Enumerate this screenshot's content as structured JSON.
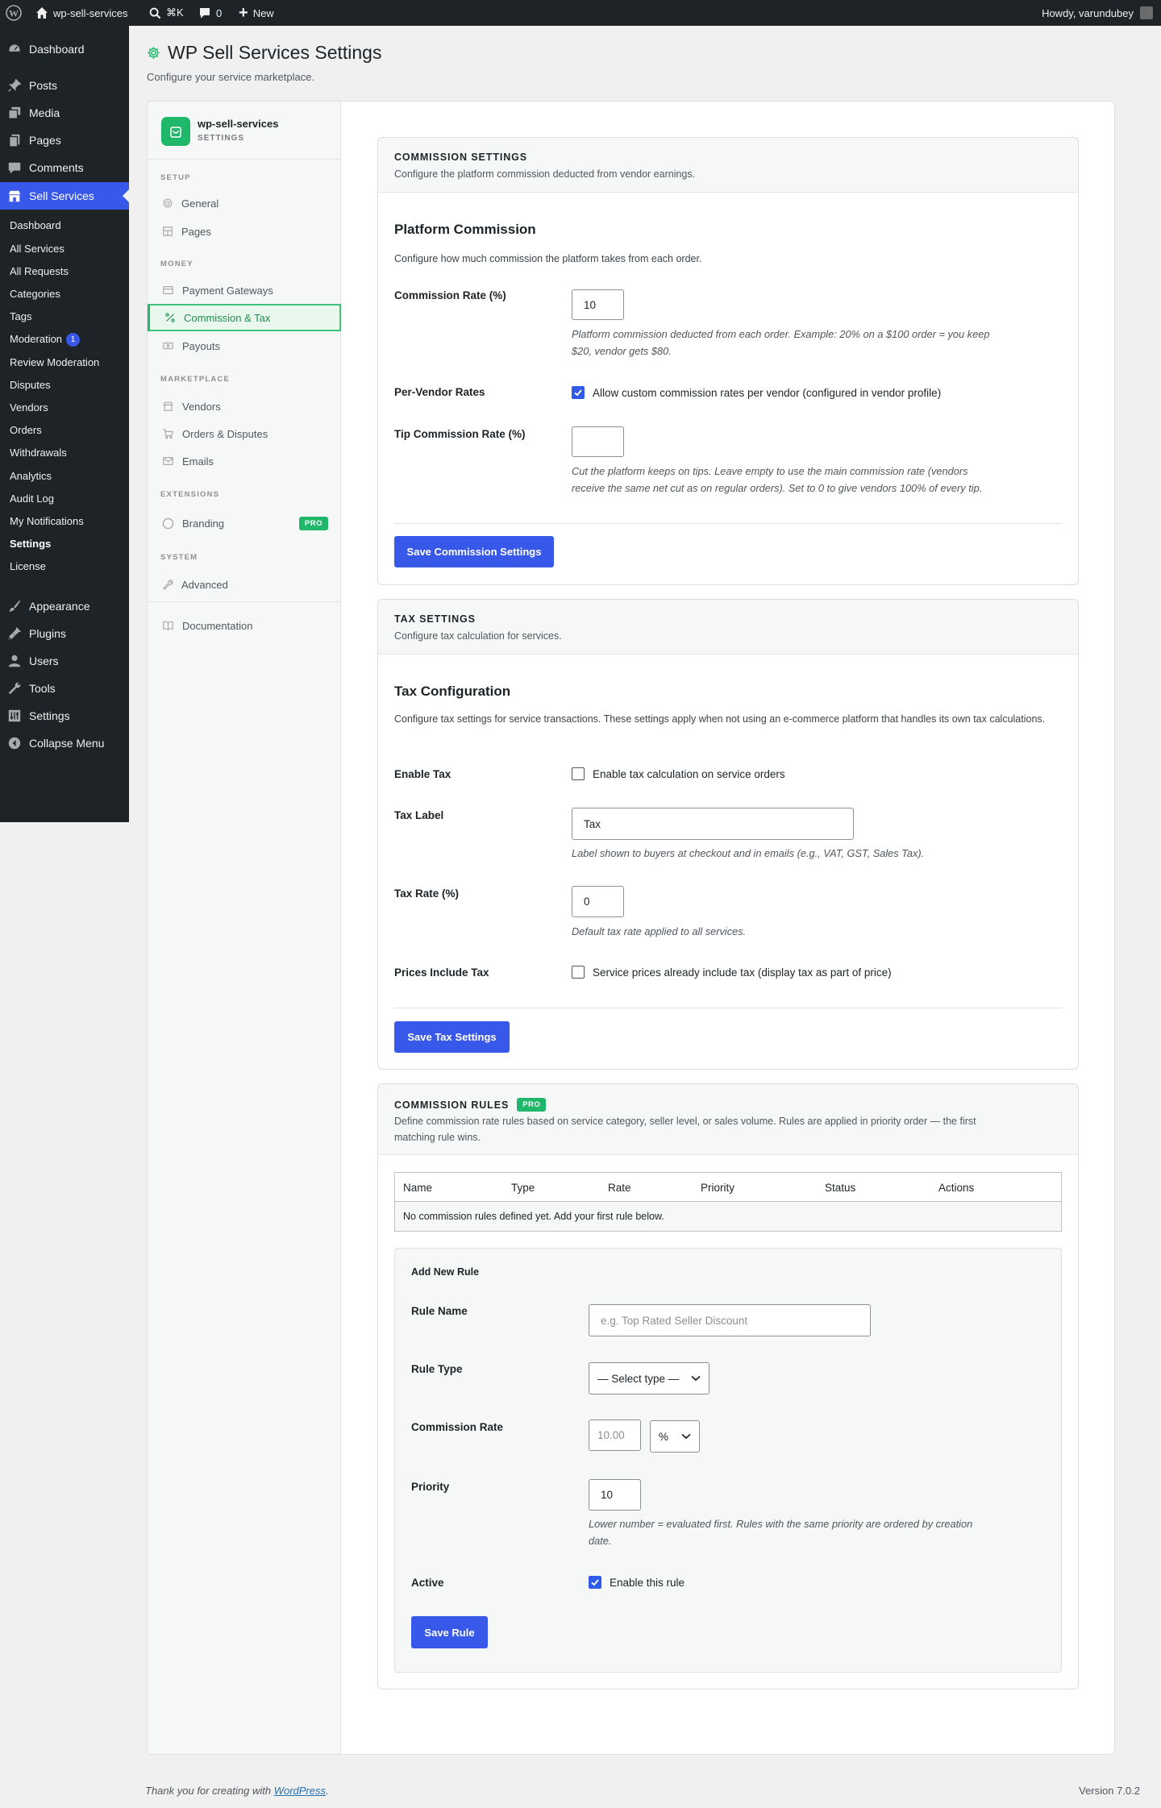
{
  "adminbar": {
    "site_name": "wp-sell-services",
    "shortcut": "⌘K",
    "comments_count": "0",
    "new_label": "New",
    "howdy": "Howdy, varundubey"
  },
  "sidebar": {
    "top": [
      "Dashboard",
      "Posts",
      "Media",
      "Pages",
      "Comments",
      "Sell Services"
    ],
    "submenu": [
      "Dashboard",
      "All Services",
      "All Requests",
      "Categories",
      "Tags",
      "Moderation",
      "Review Moderation",
      "Disputes",
      "Vendors",
      "Orders",
      "Withdrawals",
      "Analytics",
      "Audit Log",
      "My Notifications",
      "Settings",
      "License"
    ],
    "moderation_count": "1",
    "bottom": [
      "Appearance",
      "Plugins",
      "Users",
      "Tools",
      "Settings",
      "Collapse Menu"
    ]
  },
  "page": {
    "title": "WP Sell Services Settings",
    "subtitle": "Configure your service marketplace."
  },
  "nav": {
    "brand_name": "wp-sell-services",
    "brand_sub": "SETTINGS",
    "sections": {
      "setup": "SETUP",
      "money": "MONEY",
      "marketplace": "MARKETPLACE",
      "extensions": "EXTENSIONS",
      "system": "SYSTEM"
    },
    "items": {
      "general": "General",
      "pages": "Pages",
      "payment_gateways": "Payment Gateways",
      "commission_tax": "Commission & Tax",
      "payouts": "Payouts",
      "vendors": "Vendors",
      "orders_disputes": "Orders & Disputes",
      "emails": "Emails",
      "branding": "Branding",
      "advanced": "Advanced",
      "documentation": "Documentation"
    },
    "pro_label": "PRO"
  },
  "commission": {
    "head_title": "COMMISSION SETTINGS",
    "head_desc": "Configure the platform commission deducted from vendor earnings.",
    "section_title": "Platform Commission",
    "section_desc": "Configure how much commission the platform takes from each order.",
    "rate_label": "Commission Rate (%)",
    "rate_value": "10",
    "rate_help_1": "Platform commission deducted from each order. Example: 20% on a $100 order = you keep",
    "rate_help_2": "$20, vendor gets $80.",
    "per_vendor_label": "Per-Vendor Rates",
    "per_vendor_check": "Allow custom commission rates per vendor (configured in vendor profile)",
    "tip_label": "Tip Commission Rate (%)",
    "tip_value": "",
    "tip_help_1": "Cut the platform keeps on tips. Leave empty to use the main commission rate (vendors",
    "tip_help_2": "receive the same net cut as on regular orders). Set to 0 to give vendors 100% of every tip.",
    "save": "Save Commission Settings"
  },
  "tax": {
    "head_title": "TAX SETTINGS",
    "head_desc": "Configure tax calculation for services.",
    "section_title": "Tax Configuration",
    "section_desc": "Configure tax settings for service transactions. These settings apply when not using an e-commerce platform that handles its own tax calculations.",
    "enable_label": "Enable Tax",
    "enable_check": "Enable tax calculation on service orders",
    "label_label": "Tax Label",
    "label_value": "Tax",
    "label_help": "Label shown to buyers at checkout and in emails (e.g., VAT, GST, Sales Tax).",
    "rate_label": "Tax Rate (%)",
    "rate_value": "0",
    "rate_help": "Default tax rate applied to all services.",
    "incl_label": "Prices Include Tax",
    "incl_check": "Service prices already include tax (display tax as part of price)",
    "save": "Save Tax Settings"
  },
  "rules": {
    "head_title": "COMMISSION RULES",
    "pro": "PRO",
    "head_desc_1": "Define commission rate rules based on service category, seller level, or sales volume. Rules are applied in priority order — the first",
    "head_desc_2": "matching rule wins.",
    "columns": [
      "Name",
      "Type",
      "Rate",
      "Priority",
      "Status",
      "Actions"
    ],
    "empty": "No commission rules defined yet. Add your first rule below.",
    "add_title": "Add New Rule",
    "name_label": "Rule Name",
    "name_placeholder": "e.g. Top Rated Seller Discount",
    "type_label": "Rule Type",
    "type_value": "— Select type —",
    "rate_label": "Commission Rate",
    "rate_placeholder": "10.00",
    "rate_unit": "%",
    "priority_label": "Priority",
    "priority_value": "10",
    "priority_help_1": "Lower number = evaluated first. Rules with the same priority are ordered by creation",
    "priority_help_2": "date.",
    "active_label": "Active",
    "active_check": "Enable this rule",
    "save": "Save Rule"
  },
  "footer": {
    "thanks_prefix": "Thank you for creating with ",
    "wp_link": "WordPress",
    "thanks_suffix": ".",
    "version": "Version 7.0.2"
  }
}
